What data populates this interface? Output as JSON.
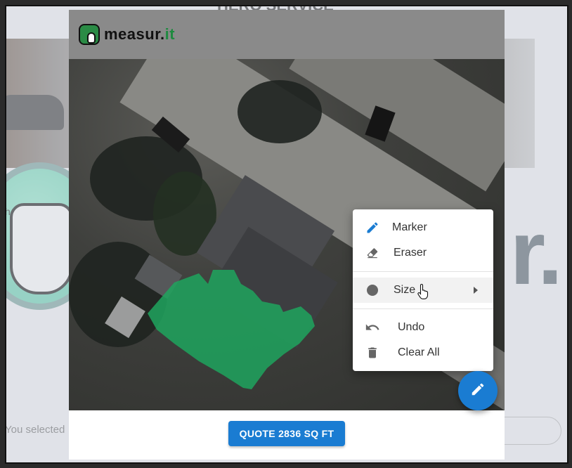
{
  "background": {
    "brand_text": "HERO SERVICE",
    "selected_text": "You selected",
    "logo_letters": "r.",
    "partial_letter": "h"
  },
  "header": {
    "logo_text_main": "measur.",
    "logo_text_accent": "it"
  },
  "menu": {
    "items": [
      {
        "label": "Marker",
        "icon": "pencil-icon"
      },
      {
        "label": "Eraser",
        "icon": "eraser-icon"
      },
      {
        "label": "Size",
        "icon": "circle-icon"
      },
      {
        "label": "Undo",
        "icon": "undo-icon"
      },
      {
        "label": "Clear All",
        "icon": "trash-icon"
      }
    ]
  },
  "footer": {
    "quote_label": "QUOTE 2836 SQ FT"
  },
  "colors": {
    "accent": "#1a7cd2",
    "lawn": "#1fa55e",
    "brand_green": "#1e8a3f"
  }
}
